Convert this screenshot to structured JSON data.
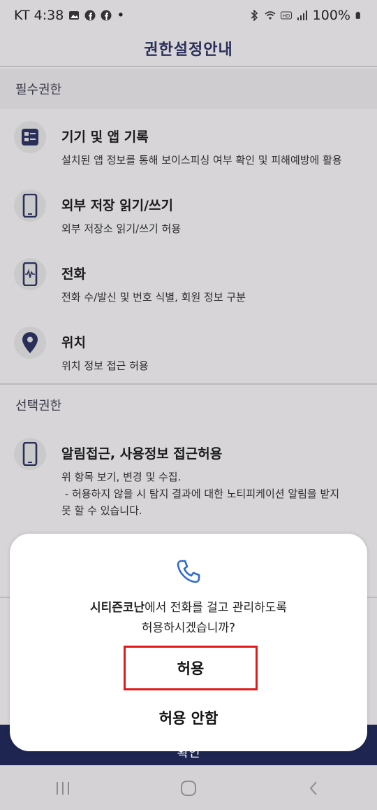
{
  "status_bar": {
    "carrier_time": "KT 4:38",
    "battery": "100%",
    "dot": "•"
  },
  "header": {
    "title": "권한설정안내"
  },
  "required": {
    "heading": "필수권한",
    "items": [
      {
        "icon": "list-icon",
        "title": "기기 및 앱 기록",
        "desc": "설치된 앱 정보를 통해 보이스피싱 여부 확인 및 피해예방에 활용"
      },
      {
        "icon": "phone-device-icon",
        "title": "외부 저장 읽기/쓰기",
        "desc": "외부 저장소 읽기/쓰기 허용"
      },
      {
        "icon": "call-device-icon",
        "title": "전화",
        "desc": "전화 수/발신 및 번호 식별, 회원 정보 구분"
      },
      {
        "icon": "location-pin-icon",
        "title": "위치",
        "desc": "위치 정보 접근 허용"
      }
    ]
  },
  "optional": {
    "heading": "선택권한",
    "items": [
      {
        "icon": "phone-device-icon",
        "title": "알림접근, 사용정보 접근허용",
        "desc_lines": [
          "위 항목 보기, 변경 및 수집.",
          " - 허용하지 않을 시 탐지 결과에 대한 노티피케이션 알림을 받지",
          "못 할 수 있습니다."
        ]
      }
    ]
  },
  "footer": {
    "label": "확인"
  },
  "dialog": {
    "icon": "phone-call-icon",
    "app_name": "시티즌코난",
    "message_rest": "에서 전화를 걸고 관리하도록",
    "message_line2": "허용하시겠습니까?",
    "allow_label": "허용",
    "deny_label": "허용 안함",
    "highlight_color": "#e01a1a"
  },
  "nav": {
    "recent": "recent-apps-icon",
    "home": "home-icon",
    "back": "back-icon"
  }
}
